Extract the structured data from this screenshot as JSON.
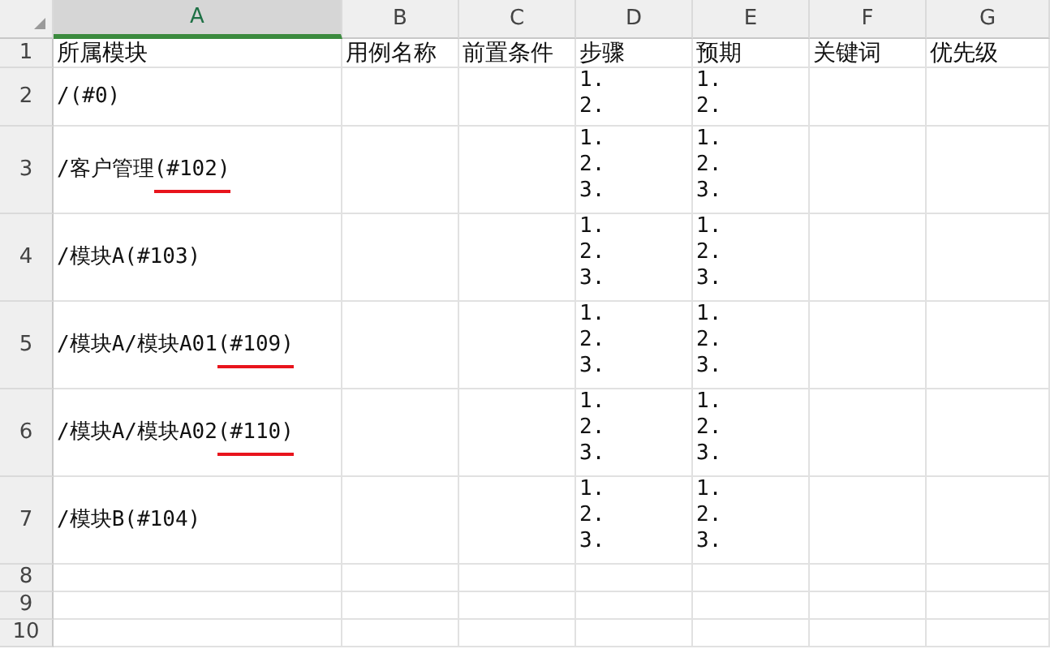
{
  "columns": [
    {
      "label": "A",
      "selected": true
    },
    {
      "label": "B",
      "selected": false
    },
    {
      "label": "C",
      "selected": false
    },
    {
      "label": "D",
      "selected": false
    },
    {
      "label": "E",
      "selected": false
    },
    {
      "label": "F",
      "selected": false
    },
    {
      "label": "G",
      "selected": false
    }
  ],
  "rows": [
    {
      "number": "1",
      "cells": {
        "A": {
          "text": "所属模块"
        },
        "B": {
          "text": "用例名称"
        },
        "C": {
          "text": "前置条件"
        },
        "D": {
          "text": "步骤"
        },
        "E": {
          "text": "预期"
        },
        "F": {
          "text": "关键词"
        },
        "G": {
          "text": "优先级"
        }
      }
    },
    {
      "number": "2",
      "cells": {
        "A": {
          "text": "/",
          "tag": "(#0)",
          "underlined": false
        },
        "D": {
          "lines": [
            "1.",
            "2."
          ]
        },
        "E": {
          "lines": [
            "1.",
            "2."
          ]
        }
      }
    },
    {
      "number": "3",
      "cells": {
        "A": {
          "text": "/客户管理",
          "tag": "(#102)",
          "underlined": true
        },
        "D": {
          "lines": [
            "1.",
            "2.",
            "3."
          ]
        },
        "E": {
          "lines": [
            "1.",
            "2.",
            "3."
          ]
        }
      }
    },
    {
      "number": "4",
      "cells": {
        "A": {
          "text": "/模块A",
          "tag": "(#103)",
          "underlined": false
        },
        "D": {
          "lines": [
            "1.",
            "2.",
            "3."
          ]
        },
        "E": {
          "lines": [
            "1.",
            "2.",
            "3."
          ]
        }
      }
    },
    {
      "number": "5",
      "cells": {
        "A": {
          "text": "/模块A/模块A01",
          "tag": "(#109)",
          "underlined": true
        },
        "D": {
          "lines": [
            "1.",
            "2.",
            "3."
          ]
        },
        "E": {
          "lines": [
            "1.",
            "2.",
            "3."
          ]
        }
      }
    },
    {
      "number": "6",
      "cells": {
        "A": {
          "text": "/模块A/模块A02",
          "tag": "(#110)",
          "underlined": true
        },
        "D": {
          "lines": [
            "1.",
            "2.",
            "3."
          ]
        },
        "E": {
          "lines": [
            "1.",
            "2.",
            "3."
          ]
        }
      }
    },
    {
      "number": "7",
      "cells": {
        "A": {
          "text": "/模块B",
          "tag": "(#104)",
          "underlined": false
        },
        "D": {
          "lines": [
            "1.",
            "2.",
            "3."
          ]
        },
        "E": {
          "lines": [
            "1.",
            "2.",
            "3."
          ]
        }
      }
    },
    {
      "number": "8",
      "cells": {}
    },
    {
      "number": "9",
      "cells": {}
    },
    {
      "number": "10",
      "cells": {}
    }
  ]
}
